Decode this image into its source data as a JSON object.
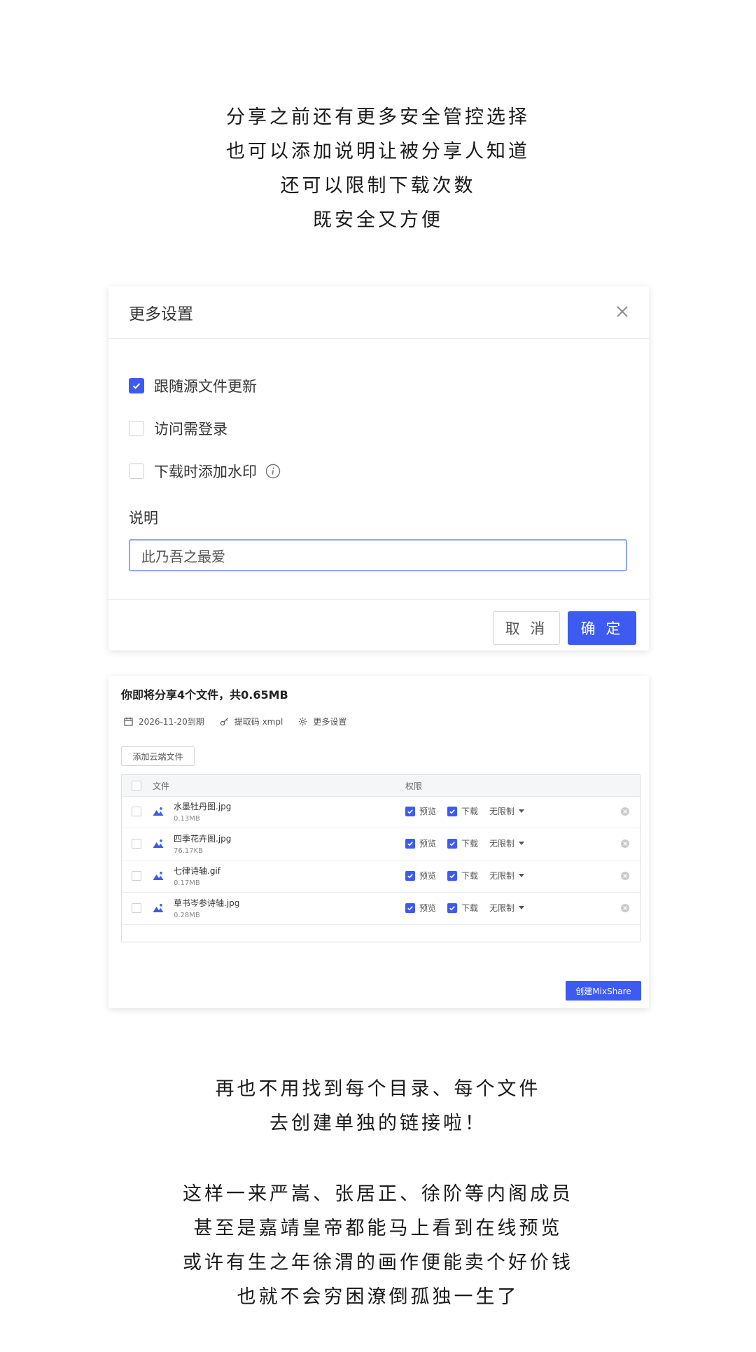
{
  "captions": {
    "top": [
      "分享之前还有更多安全管控选择",
      "也可以添加说明让被分享人知道",
      "还可以限制下载次数",
      "既安全又方便"
    ],
    "middle": [
      "再也不用找到每个目录、每个文件",
      "去创建单独的链接啦！"
    ],
    "bottom": [
      "这样一来严嵩、张居正、徐阶等内阁成员",
      "甚至是嘉靖皇帝都能马上看到在线预览",
      "或许有生之年徐渭的画作便能卖个好价钱",
      "也就不会穷困潦倒孤独一生了"
    ]
  },
  "dialog": {
    "title": "更多设置",
    "options": [
      {
        "label": "跟随源文件更新",
        "checked": true
      },
      {
        "label": "访问需登录",
        "checked": false
      },
      {
        "label": "下载时添加水印",
        "checked": false
      }
    ],
    "description_label": "说明",
    "description_value": "此乃吾之最爱",
    "cancel_label": "取 消",
    "confirm_label": "确 定"
  },
  "share": {
    "title": "你即将分享4个文件，共0.65MB",
    "expiry": "2026-11-20到期",
    "code": "提取码 xmpl",
    "more_settings": "更多设置",
    "add_cloud_files": "添加云端文件",
    "col_file": "文件",
    "col_permission": "权限",
    "files": [
      {
        "name": "水墨牡丹图.jpg",
        "size": "0.13MB",
        "preview": "预览",
        "download": "下载",
        "limit": "无限制"
      },
      {
        "name": "四季花卉图.jpg",
        "size": "76.17KB",
        "preview": "预览",
        "download": "下载",
        "limit": "无限制"
      },
      {
        "name": "七律诗轴.gif",
        "size": "0.17MB",
        "preview": "预览",
        "download": "下载",
        "limit": "无限制"
      },
      {
        "name": "草书岑参诗轴.jpg",
        "size": "0.28MB",
        "preview": "预览",
        "download": "下载",
        "limit": "无限制"
      }
    ],
    "create_button": "创建MixShare"
  },
  "colors": {
    "accent": "#3d5bf0",
    "input_border": "#8fa6f5"
  }
}
